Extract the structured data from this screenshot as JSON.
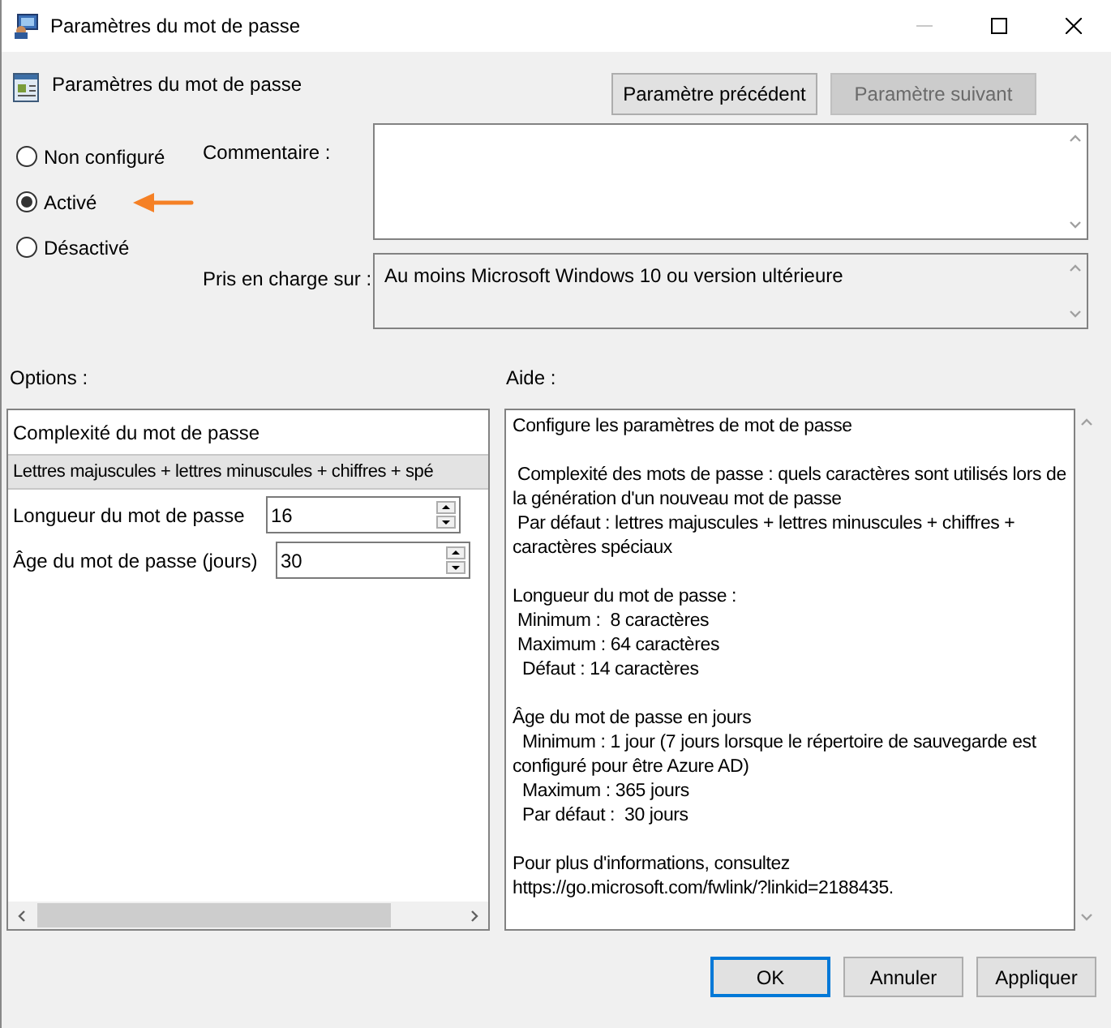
{
  "window": {
    "title": "Paramètres du mot de passe"
  },
  "header": {
    "title": "Paramètres du mot de passe",
    "buttons": [
      {
        "label": "Paramètre précédent",
        "disabled": false
      },
      {
        "label": "Paramètre suivant",
        "disabled": true
      }
    ]
  },
  "state_options": [
    {
      "label": "Non configuré",
      "selected": false
    },
    {
      "label": "Activé",
      "selected": true
    },
    {
      "label": "Désactivé",
      "selected": false
    }
  ],
  "comment": {
    "label": "Commentaire :"
  },
  "supported_on": {
    "label": "Pris en charge sur :",
    "value": "Au moins Microsoft Windows 10 ou version ultérieure"
  },
  "options": {
    "label": "Options :",
    "heading": "Complexité du mot de passe",
    "complexity_value": "Lettres majuscules + lettres minuscules + chiffres + spé",
    "spinners": [
      {
        "label": "Longueur du mot de passe",
        "value": "16"
      },
      {
        "label": "Âge du mot de passe (jours)",
        "value": "30"
      }
    ]
  },
  "help": {
    "label": "Aide :",
    "text": "Configure les paramètres de mot de passe\n\n Complexité des mots de passe : quels caractères sont utilisés lors de la génération d'un nouveau mot de passe\n Par défaut : lettres majuscules + lettres minuscules + chiffres + caractères spéciaux\n\nLongueur du mot de passe :\n Minimum :  8 caractères\n Maximum : 64 caractères\n  Défaut : 14 caractères\n\nÂge du mot de passe en jours\n  Minimum : 1 jour (7 jours lorsque le répertoire de sauvegarde est configuré pour être Azure AD)\n  Maximum : 365 jours\n  Par défaut :  30 jours\n\nPour plus d'informations, consultez\nhttps://go.microsoft.com/fwlink/?linkid=2188435."
  },
  "footer_buttons": [
    {
      "label": "OK",
      "default": true
    },
    {
      "label": "Annuler",
      "default": false
    },
    {
      "label": "Appliquer",
      "default": false
    }
  ]
}
